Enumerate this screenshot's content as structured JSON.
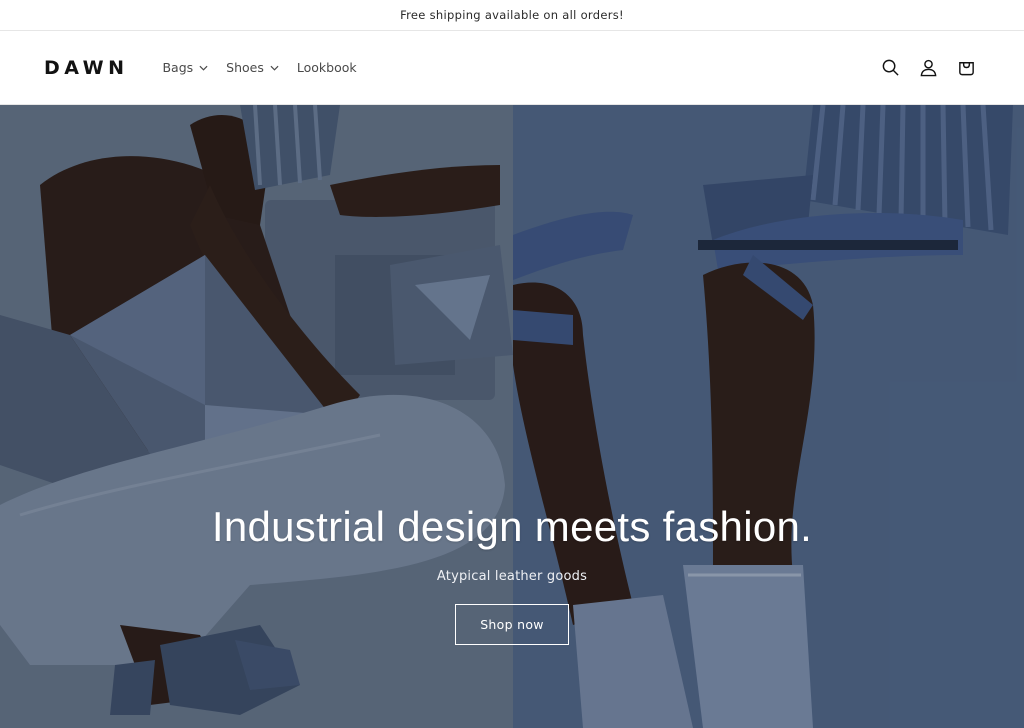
{
  "announcement": {
    "text": "Free shipping available on all orders!"
  },
  "header": {
    "logo": "DAWN",
    "nav": [
      {
        "label": "Bags",
        "has_dropdown": true
      },
      {
        "label": "Shoes",
        "has_dropdown": true
      },
      {
        "label": "Lookbook",
        "has_dropdown": false
      }
    ],
    "icons": [
      "search-icon",
      "account-icon",
      "cart-icon"
    ]
  },
  "hero": {
    "title": "Industrial design meets fashion.",
    "subtitle": "Atypical leather goods",
    "cta_label": "Shop now"
  },
  "colors": {
    "hero_left_bg": "#5f6f86",
    "hero_right_bg": "#4f6587",
    "text": "#121212"
  }
}
